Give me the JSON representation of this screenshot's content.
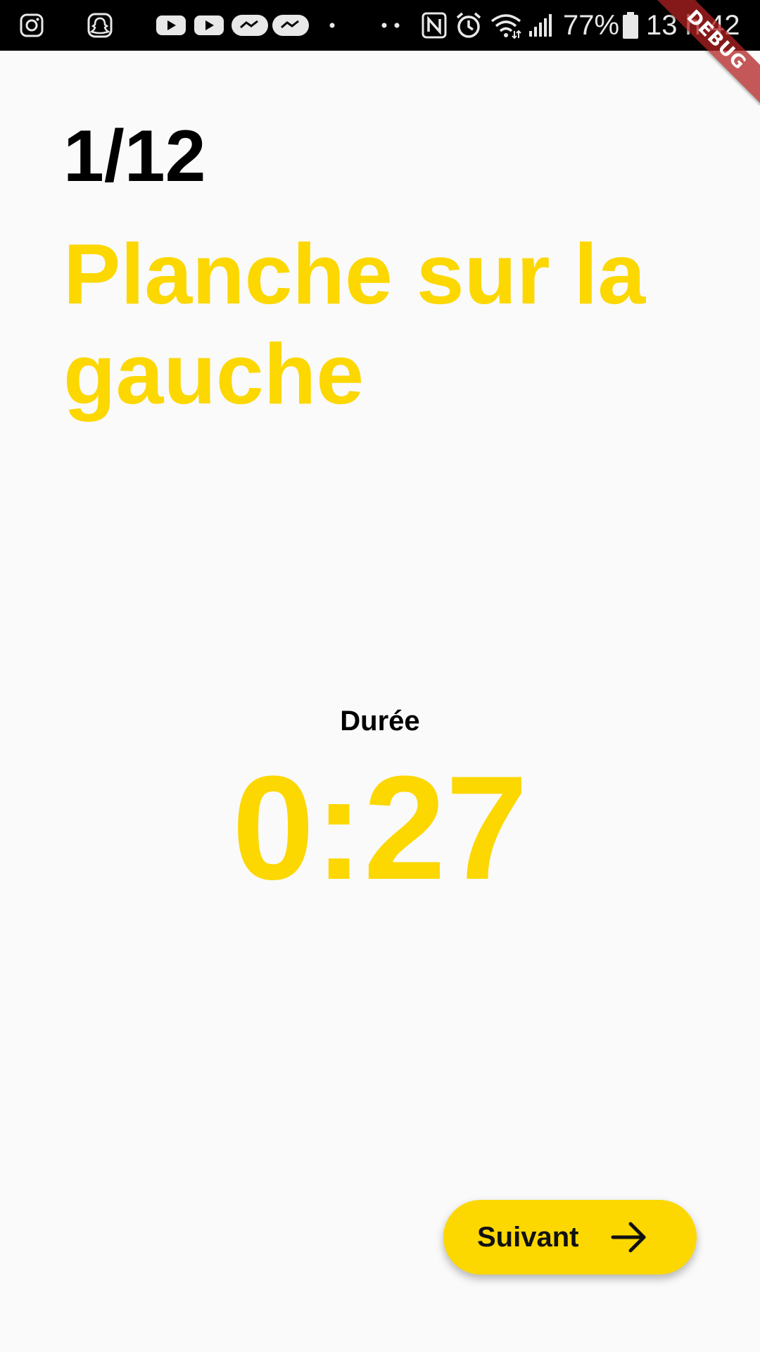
{
  "status_bar": {
    "battery_percent": "77%",
    "time": "13 h 42",
    "left_icons": [
      "instagram-icon",
      "snapchat-icon",
      "youtube-icon",
      "youtube-icon",
      "messenger-icon",
      "messenger-icon",
      "dot-icon",
      "more-dots-icon"
    ],
    "right_icons": [
      "nfc-icon",
      "alarm-icon",
      "wifi-icon",
      "signal-icon",
      "battery-icon"
    ]
  },
  "debug_banner": {
    "label": "DEBUG"
  },
  "workout": {
    "step": "1/12",
    "exercise_name": "Planche sur la gauche",
    "duration_label": "Durée",
    "timer": "0:27"
  },
  "actions": {
    "next_label": "Suivant",
    "next_icon": "arrow-right-icon"
  },
  "colors": {
    "accent": "#fcd700",
    "background": "#fafafa",
    "text": "#000000",
    "debug_ribbon": "#b22222"
  }
}
